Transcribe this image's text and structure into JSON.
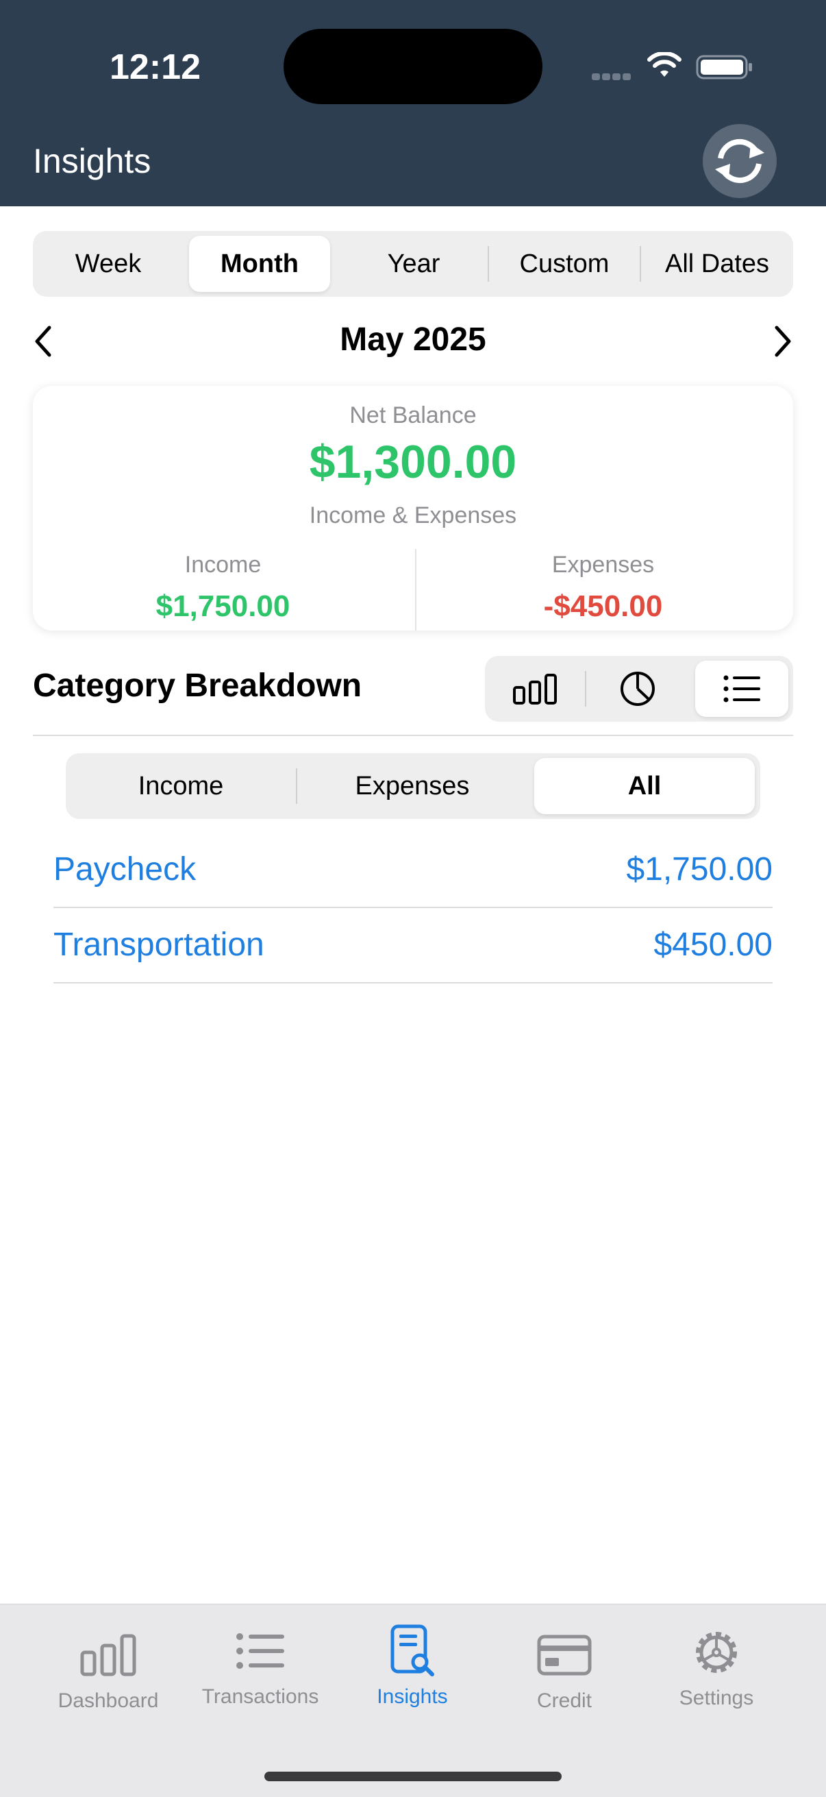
{
  "status_bar": {
    "time": "12:12"
  },
  "header": {
    "title": "Insights",
    "sync_icon": "refresh-icon"
  },
  "period_tabs": [
    "Week",
    "Month",
    "Year",
    "Custom",
    "All Dates"
  ],
  "period_selected": "Month",
  "month_nav": {
    "label": "May 2025"
  },
  "summary": {
    "net_label": "Net Balance",
    "net_value": "$1,300.00",
    "subtitle": "Income & Expenses",
    "income_label": "Income",
    "income_value": "$1,750.00",
    "expenses_label": "Expenses",
    "expenses_value": "-$450.00"
  },
  "category": {
    "title": "Category Breakdown",
    "views": [
      "bar-chart-icon",
      "pie-chart-icon",
      "list-icon"
    ],
    "view_selected": "list-icon",
    "types": [
      "Income",
      "Expenses",
      "All"
    ],
    "type_selected": "All",
    "rows": [
      {
        "name": "Paycheck",
        "amount": "$1,750.00"
      },
      {
        "name": "Transportation",
        "amount": "$450.00"
      }
    ]
  },
  "tabbar": [
    {
      "label": "Dashboard",
      "icon": "bar-chart-icon"
    },
    {
      "label": "Transactions",
      "icon": "list-icon"
    },
    {
      "label": "Insights",
      "icon": "document-search-icon"
    },
    {
      "label": "Credit",
      "icon": "credit-card-icon"
    },
    {
      "label": "Settings",
      "icon": "gear-icon"
    }
  ],
  "tab_selected": "Insights",
  "colors": {
    "header_bg": "#2e3e51",
    "positive": "#2dc46a",
    "negative": "#e04a3f",
    "accent": "#1e7fe0"
  }
}
